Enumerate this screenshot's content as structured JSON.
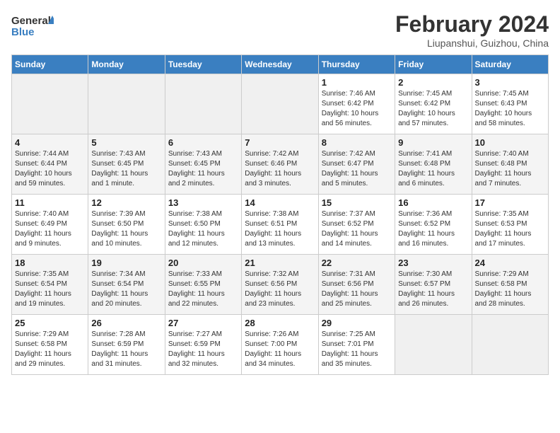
{
  "logo": {
    "line1": "General",
    "line2": "Blue"
  },
  "title": {
    "month_year": "February 2024",
    "location": "Liupanshui, Guizhou, China"
  },
  "weekdays": [
    "Sunday",
    "Monday",
    "Tuesday",
    "Wednesday",
    "Thursday",
    "Friday",
    "Saturday"
  ],
  "weeks": [
    [
      {
        "day": "",
        "info": ""
      },
      {
        "day": "",
        "info": ""
      },
      {
        "day": "",
        "info": ""
      },
      {
        "day": "",
        "info": ""
      },
      {
        "day": "1",
        "info": "Sunrise: 7:46 AM\nSunset: 6:42 PM\nDaylight: 10 hours\nand 56 minutes."
      },
      {
        "day": "2",
        "info": "Sunrise: 7:45 AM\nSunset: 6:42 PM\nDaylight: 10 hours\nand 57 minutes."
      },
      {
        "day": "3",
        "info": "Sunrise: 7:45 AM\nSunset: 6:43 PM\nDaylight: 10 hours\nand 58 minutes."
      }
    ],
    [
      {
        "day": "4",
        "info": "Sunrise: 7:44 AM\nSunset: 6:44 PM\nDaylight: 10 hours\nand 59 minutes."
      },
      {
        "day": "5",
        "info": "Sunrise: 7:43 AM\nSunset: 6:45 PM\nDaylight: 11 hours\nand 1 minute."
      },
      {
        "day": "6",
        "info": "Sunrise: 7:43 AM\nSunset: 6:45 PM\nDaylight: 11 hours\nand 2 minutes."
      },
      {
        "day": "7",
        "info": "Sunrise: 7:42 AM\nSunset: 6:46 PM\nDaylight: 11 hours\nand 3 minutes."
      },
      {
        "day": "8",
        "info": "Sunrise: 7:42 AM\nSunset: 6:47 PM\nDaylight: 11 hours\nand 5 minutes."
      },
      {
        "day": "9",
        "info": "Sunrise: 7:41 AM\nSunset: 6:48 PM\nDaylight: 11 hours\nand 6 minutes."
      },
      {
        "day": "10",
        "info": "Sunrise: 7:40 AM\nSunset: 6:48 PM\nDaylight: 11 hours\nand 7 minutes."
      }
    ],
    [
      {
        "day": "11",
        "info": "Sunrise: 7:40 AM\nSunset: 6:49 PM\nDaylight: 11 hours\nand 9 minutes."
      },
      {
        "day": "12",
        "info": "Sunrise: 7:39 AM\nSunset: 6:50 PM\nDaylight: 11 hours\nand 10 minutes."
      },
      {
        "day": "13",
        "info": "Sunrise: 7:38 AM\nSunset: 6:50 PM\nDaylight: 11 hours\nand 12 minutes."
      },
      {
        "day": "14",
        "info": "Sunrise: 7:38 AM\nSunset: 6:51 PM\nDaylight: 11 hours\nand 13 minutes."
      },
      {
        "day": "15",
        "info": "Sunrise: 7:37 AM\nSunset: 6:52 PM\nDaylight: 11 hours\nand 14 minutes."
      },
      {
        "day": "16",
        "info": "Sunrise: 7:36 AM\nSunset: 6:52 PM\nDaylight: 11 hours\nand 16 minutes."
      },
      {
        "day": "17",
        "info": "Sunrise: 7:35 AM\nSunset: 6:53 PM\nDaylight: 11 hours\nand 17 minutes."
      }
    ],
    [
      {
        "day": "18",
        "info": "Sunrise: 7:35 AM\nSunset: 6:54 PM\nDaylight: 11 hours\nand 19 minutes."
      },
      {
        "day": "19",
        "info": "Sunrise: 7:34 AM\nSunset: 6:54 PM\nDaylight: 11 hours\nand 20 minutes."
      },
      {
        "day": "20",
        "info": "Sunrise: 7:33 AM\nSunset: 6:55 PM\nDaylight: 11 hours\nand 22 minutes."
      },
      {
        "day": "21",
        "info": "Sunrise: 7:32 AM\nSunset: 6:56 PM\nDaylight: 11 hours\nand 23 minutes."
      },
      {
        "day": "22",
        "info": "Sunrise: 7:31 AM\nSunset: 6:56 PM\nDaylight: 11 hours\nand 25 minutes."
      },
      {
        "day": "23",
        "info": "Sunrise: 7:30 AM\nSunset: 6:57 PM\nDaylight: 11 hours\nand 26 minutes."
      },
      {
        "day": "24",
        "info": "Sunrise: 7:29 AM\nSunset: 6:58 PM\nDaylight: 11 hours\nand 28 minutes."
      }
    ],
    [
      {
        "day": "25",
        "info": "Sunrise: 7:29 AM\nSunset: 6:58 PM\nDaylight: 11 hours\nand 29 minutes."
      },
      {
        "day": "26",
        "info": "Sunrise: 7:28 AM\nSunset: 6:59 PM\nDaylight: 11 hours\nand 31 minutes."
      },
      {
        "day": "27",
        "info": "Sunrise: 7:27 AM\nSunset: 6:59 PM\nDaylight: 11 hours\nand 32 minutes."
      },
      {
        "day": "28",
        "info": "Sunrise: 7:26 AM\nSunset: 7:00 PM\nDaylight: 11 hours\nand 34 minutes."
      },
      {
        "day": "29",
        "info": "Sunrise: 7:25 AM\nSunset: 7:01 PM\nDaylight: 11 hours\nand 35 minutes."
      },
      {
        "day": "",
        "info": ""
      },
      {
        "day": "",
        "info": ""
      }
    ]
  ]
}
